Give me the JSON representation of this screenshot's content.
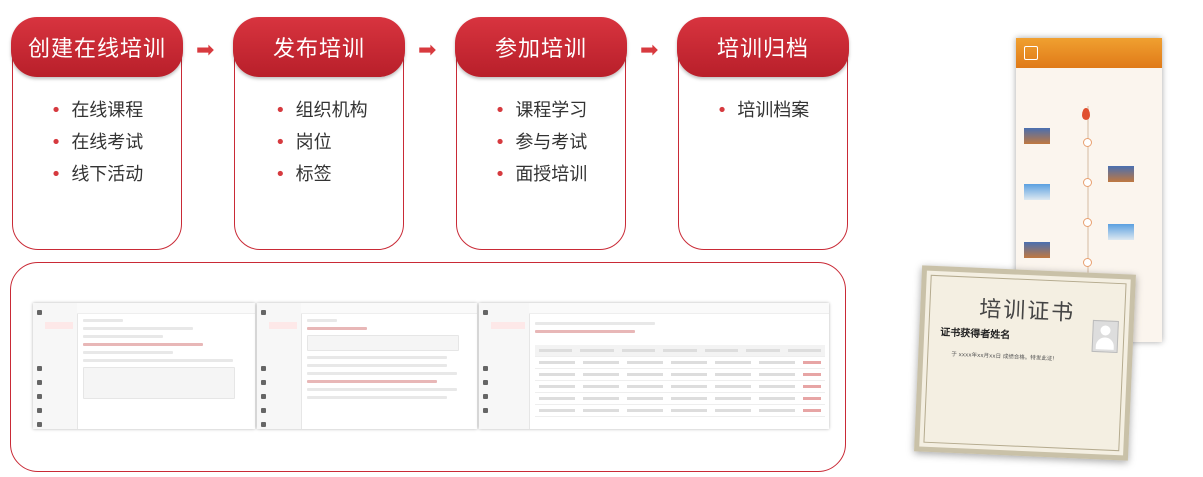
{
  "steps": [
    {
      "title": "创建在线培训",
      "items": [
        "在线课程",
        "在线考试",
        "线下活动"
      ]
    },
    {
      "title": "发布培训",
      "items": [
        "组织机构",
        "岗位",
        "标签"
      ]
    },
    {
      "title": "参加培训",
      "items": [
        "课程学习",
        "参与考试",
        "面授培训"
      ]
    },
    {
      "title": "培训归档",
      "items": [
        "培训档案"
      ]
    }
  ],
  "arrow_glyph": "➡",
  "bullet": "•",
  "certificate": {
    "title": "培训证书",
    "name": "证书获得者姓名",
    "text": "于  xxxx年xx月xx日  成绩合格。特发此证!"
  },
  "colors": {
    "accent": "#c92a36",
    "orange": "#e8841e"
  },
  "icons": [
    "arrow-right-icon",
    "avatar-placeholder-icon"
  ]
}
